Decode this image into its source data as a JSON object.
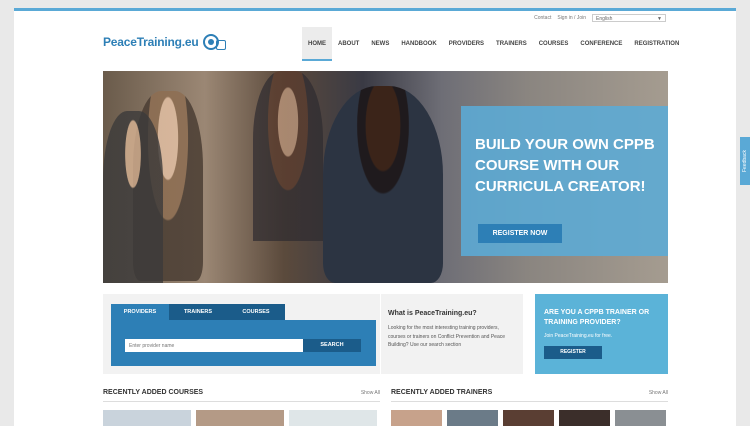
{
  "topbar": {
    "contact": "Contact",
    "signin": "Sign in / Join",
    "language": "English"
  },
  "logo": {
    "text": "PeaceTraining.eu"
  },
  "nav": [
    {
      "label": "HOME",
      "active": true
    },
    {
      "label": "ABOUT"
    },
    {
      "label": "NEWS"
    },
    {
      "label": "HANDBOOK"
    },
    {
      "label": "PROVIDERS"
    },
    {
      "label": "TRAINERS"
    },
    {
      "label": "COURSES"
    },
    {
      "label": "CONFERENCE"
    },
    {
      "label": "REGISTRATION"
    }
  ],
  "hero": {
    "title": "BUILD YOUR OWN CPPB COURSE WITH OUR CURRICULA CREATOR!",
    "button": "REGISTER NOW"
  },
  "search": {
    "tabs": [
      "PROVIDERS",
      "TRAINERS",
      "COURSES"
    ],
    "placeholder": "Enter provider name",
    "button": "SEARCH"
  },
  "what": {
    "title": "What is PeaceTraining.eu?",
    "text": "Looking for the most interesting training providers, courses or trainers on Conflict Prevention and Peace Building? Use our search section"
  },
  "trainer_box": {
    "title": "ARE YOU A CPPB TRAINER OR TRAINING PROVIDER?",
    "text": "Join PeaceTraining.eu for free.",
    "button": "REGISTER"
  },
  "sections": {
    "courses": {
      "title": "RECENTLY ADDED COURSES",
      "link": "Show All"
    },
    "trainers": {
      "title": "RECENTLY ADDED TRAINERS",
      "link": "Show All"
    }
  },
  "feedback": "Feedback",
  "colors": {
    "accent": "#2d7fb6",
    "light_accent": "#5bb3d8",
    "dark_accent": "#1b5c8a"
  }
}
